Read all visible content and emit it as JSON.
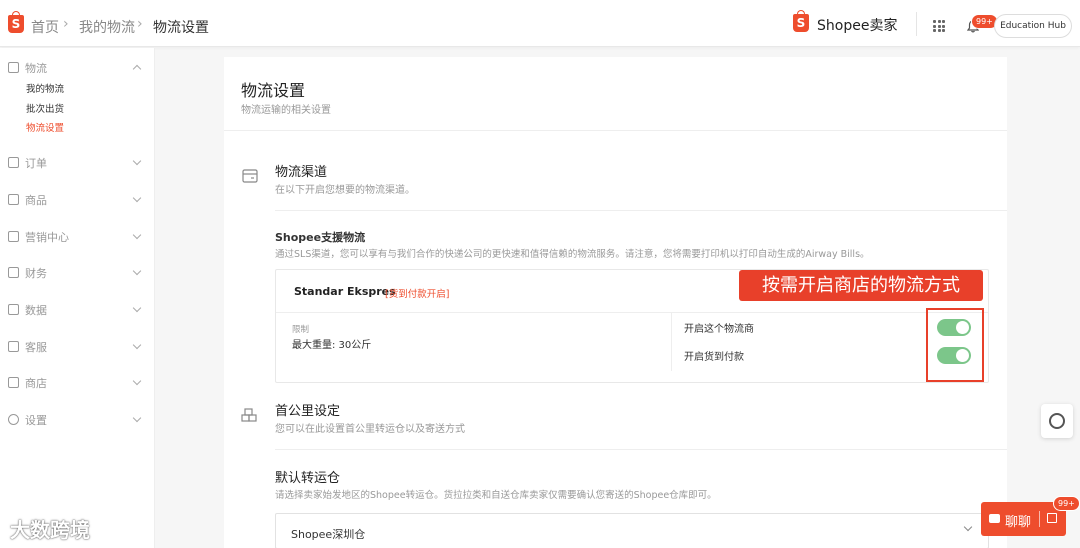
{
  "breadcrumb": {
    "home": "首页",
    "my_logistics": "我的物流",
    "current": "物流设置"
  },
  "header": {
    "brand": "Shopee卖家",
    "notification_badge": "99+",
    "education_hub": "Education Hub"
  },
  "sidebar": {
    "sections": [
      {
        "label": "物流",
        "icon": "truck-icon",
        "expanded": true
      },
      {
        "label": "订单",
        "icon": "order-icon"
      },
      {
        "label": "商品",
        "icon": "product-icon"
      },
      {
        "label": "营销中心",
        "icon": "tag-icon"
      },
      {
        "label": "财务",
        "icon": "wallet-icon"
      },
      {
        "label": "数据",
        "icon": "chart-icon"
      },
      {
        "label": "客服",
        "icon": "chat-icon"
      },
      {
        "label": "商店",
        "icon": "shop-icon"
      },
      {
        "label": "设置",
        "icon": "gear-icon"
      }
    ],
    "logistics_items": [
      "我的物流",
      "批次出货",
      "物流设置"
    ]
  },
  "page": {
    "title": "物流设置",
    "subtitle": "物流运输的相关设置"
  },
  "channels": {
    "title": "物流渠道",
    "subtitle": "在以下开启您想要的物流渠道。",
    "supported_title": "Shopee支援物流",
    "supported_desc": "通过SLS渠道，您可以享有与我们合作的快递公司的更快速和值得信赖的物流服务。请注意，您将需要打印机以打印自动生成的Airway Bills。",
    "carrier": {
      "name": "Standar Ekspres",
      "tag": "[货到付款开启]",
      "limit_label": "限制",
      "limit_value": "最大重量: 30公斤",
      "toggle_enable_label": "开启这个物流商",
      "toggle_enable_on": true,
      "toggle_cod_label": "开启货到付款",
      "toggle_cod_on": true
    },
    "callout": "按需开启商店的物流方式"
  },
  "first_mile": {
    "title": "首公里设定",
    "subtitle": "您可以在此设置首公里转运仓以及寄送方式"
  },
  "default_warehouse": {
    "title": "默认转运仓",
    "desc": "请选择卖家始发地区的Shopee转运仓。货拉拉类和自送仓库卖家仅需要确认您寄送的Shopee仓库即可。",
    "selected": "Shopee深圳仓"
  },
  "chat": {
    "label": "聊聊",
    "badge": "99+"
  },
  "watermark": "大数跨境",
  "colors": {
    "accent": "#ee4d2d",
    "toggle_on": "#7cc68a",
    "annotation": "#e8402a"
  }
}
